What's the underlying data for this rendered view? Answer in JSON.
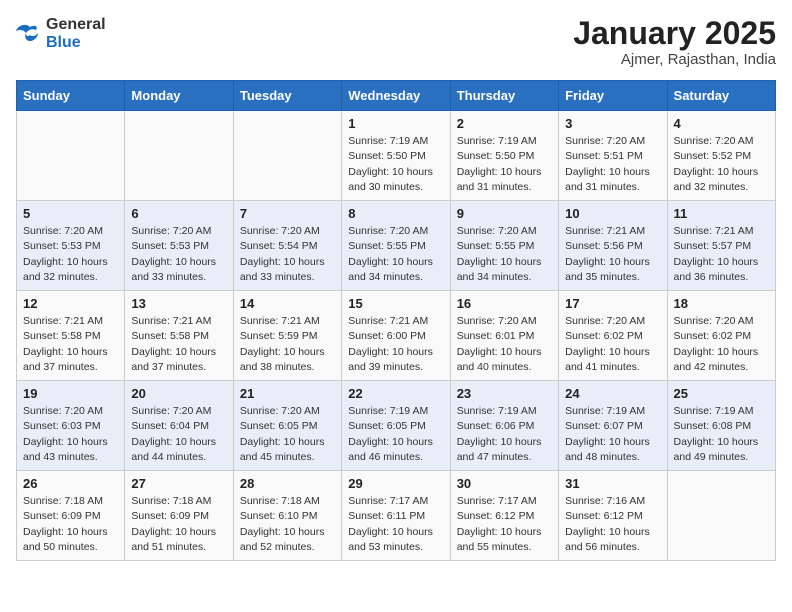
{
  "logo": {
    "text_general": "General",
    "text_blue": "Blue"
  },
  "title": "January 2025",
  "subtitle": "Ajmer, Rajasthan, India",
  "days_of_week": [
    "Sunday",
    "Monday",
    "Tuesday",
    "Wednesday",
    "Thursday",
    "Friday",
    "Saturday"
  ],
  "weeks": [
    [
      {
        "day": "",
        "info": ""
      },
      {
        "day": "",
        "info": ""
      },
      {
        "day": "",
        "info": ""
      },
      {
        "day": "1",
        "info": "Sunrise: 7:19 AM\nSunset: 5:50 PM\nDaylight: 10 hours\nand 30 minutes."
      },
      {
        "day": "2",
        "info": "Sunrise: 7:19 AM\nSunset: 5:50 PM\nDaylight: 10 hours\nand 31 minutes."
      },
      {
        "day": "3",
        "info": "Sunrise: 7:20 AM\nSunset: 5:51 PM\nDaylight: 10 hours\nand 31 minutes."
      },
      {
        "day": "4",
        "info": "Sunrise: 7:20 AM\nSunset: 5:52 PM\nDaylight: 10 hours\nand 32 minutes."
      }
    ],
    [
      {
        "day": "5",
        "info": "Sunrise: 7:20 AM\nSunset: 5:53 PM\nDaylight: 10 hours\nand 32 minutes."
      },
      {
        "day": "6",
        "info": "Sunrise: 7:20 AM\nSunset: 5:53 PM\nDaylight: 10 hours\nand 33 minutes."
      },
      {
        "day": "7",
        "info": "Sunrise: 7:20 AM\nSunset: 5:54 PM\nDaylight: 10 hours\nand 33 minutes."
      },
      {
        "day": "8",
        "info": "Sunrise: 7:20 AM\nSunset: 5:55 PM\nDaylight: 10 hours\nand 34 minutes."
      },
      {
        "day": "9",
        "info": "Sunrise: 7:20 AM\nSunset: 5:55 PM\nDaylight: 10 hours\nand 34 minutes."
      },
      {
        "day": "10",
        "info": "Sunrise: 7:21 AM\nSunset: 5:56 PM\nDaylight: 10 hours\nand 35 minutes."
      },
      {
        "day": "11",
        "info": "Sunrise: 7:21 AM\nSunset: 5:57 PM\nDaylight: 10 hours\nand 36 minutes."
      }
    ],
    [
      {
        "day": "12",
        "info": "Sunrise: 7:21 AM\nSunset: 5:58 PM\nDaylight: 10 hours\nand 37 minutes."
      },
      {
        "day": "13",
        "info": "Sunrise: 7:21 AM\nSunset: 5:58 PM\nDaylight: 10 hours\nand 37 minutes."
      },
      {
        "day": "14",
        "info": "Sunrise: 7:21 AM\nSunset: 5:59 PM\nDaylight: 10 hours\nand 38 minutes."
      },
      {
        "day": "15",
        "info": "Sunrise: 7:21 AM\nSunset: 6:00 PM\nDaylight: 10 hours\nand 39 minutes."
      },
      {
        "day": "16",
        "info": "Sunrise: 7:20 AM\nSunset: 6:01 PM\nDaylight: 10 hours\nand 40 minutes."
      },
      {
        "day": "17",
        "info": "Sunrise: 7:20 AM\nSunset: 6:02 PM\nDaylight: 10 hours\nand 41 minutes."
      },
      {
        "day": "18",
        "info": "Sunrise: 7:20 AM\nSunset: 6:02 PM\nDaylight: 10 hours\nand 42 minutes."
      }
    ],
    [
      {
        "day": "19",
        "info": "Sunrise: 7:20 AM\nSunset: 6:03 PM\nDaylight: 10 hours\nand 43 minutes."
      },
      {
        "day": "20",
        "info": "Sunrise: 7:20 AM\nSunset: 6:04 PM\nDaylight: 10 hours\nand 44 minutes."
      },
      {
        "day": "21",
        "info": "Sunrise: 7:20 AM\nSunset: 6:05 PM\nDaylight: 10 hours\nand 45 minutes."
      },
      {
        "day": "22",
        "info": "Sunrise: 7:19 AM\nSunset: 6:05 PM\nDaylight: 10 hours\nand 46 minutes."
      },
      {
        "day": "23",
        "info": "Sunrise: 7:19 AM\nSunset: 6:06 PM\nDaylight: 10 hours\nand 47 minutes."
      },
      {
        "day": "24",
        "info": "Sunrise: 7:19 AM\nSunset: 6:07 PM\nDaylight: 10 hours\nand 48 minutes."
      },
      {
        "day": "25",
        "info": "Sunrise: 7:19 AM\nSunset: 6:08 PM\nDaylight: 10 hours\nand 49 minutes."
      }
    ],
    [
      {
        "day": "26",
        "info": "Sunrise: 7:18 AM\nSunset: 6:09 PM\nDaylight: 10 hours\nand 50 minutes."
      },
      {
        "day": "27",
        "info": "Sunrise: 7:18 AM\nSunset: 6:09 PM\nDaylight: 10 hours\nand 51 minutes."
      },
      {
        "day": "28",
        "info": "Sunrise: 7:18 AM\nSunset: 6:10 PM\nDaylight: 10 hours\nand 52 minutes."
      },
      {
        "day": "29",
        "info": "Sunrise: 7:17 AM\nSunset: 6:11 PM\nDaylight: 10 hours\nand 53 minutes."
      },
      {
        "day": "30",
        "info": "Sunrise: 7:17 AM\nSunset: 6:12 PM\nDaylight: 10 hours\nand 55 minutes."
      },
      {
        "day": "31",
        "info": "Sunrise: 7:16 AM\nSunset: 6:12 PM\nDaylight: 10 hours\nand 56 minutes."
      },
      {
        "day": "",
        "info": ""
      }
    ]
  ]
}
